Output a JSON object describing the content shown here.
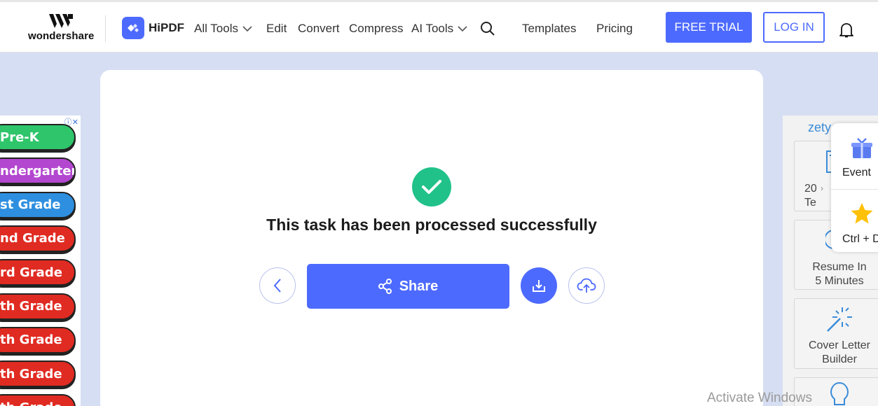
{
  "header": {
    "brand": "wondershare",
    "product": "HiPDF",
    "nav": {
      "all_tools": "All Tools",
      "edit": "Edit",
      "convert": "Convert",
      "compress": "Compress",
      "ai_tools": "AI Tools",
      "templates": "Templates",
      "pricing": "Pricing"
    },
    "free_trial": "FREE TRIAL",
    "login": "LOG IN"
  },
  "main": {
    "status_message": "This task has been processed successfully",
    "share_label": "Share"
  },
  "ad_left": {
    "items": [
      {
        "label": "Pre-K",
        "color": "#2fc56b"
      },
      {
        "label": "ndergarten",
        "color": "#b347d0"
      },
      {
        "label": "st Grade",
        "color": "#2e8fe0"
      },
      {
        "label": "nd Grade",
        "color": "#e02b22"
      },
      {
        "label": "rd Grade",
        "color": "#e02b22"
      },
      {
        "label": "th Grade",
        "color": "#e02b22"
      },
      {
        "label": "th Grade",
        "color": "#e02b22"
      },
      {
        "label": "th Grade",
        "color": "#e02b22"
      },
      {
        "label": "th Grade",
        "color": "#e02b22"
      }
    ]
  },
  "ad_right": {
    "brand": "zety",
    "tiles": {
      "t1_line1": "20",
      "t1_line2": "Te",
      "t2_line1": "Resume In",
      "t2_line2": "5 Minutes",
      "t3_line1": "Cover Letter",
      "t3_line2": "Builder"
    }
  },
  "floater": {
    "event": "Event",
    "bookmark": "Ctrl + D"
  },
  "watermark": "Activate Windows",
  "colors": {
    "accent": "#4d6aff",
    "success": "#21c28a",
    "page_bg": "#d6def3"
  }
}
